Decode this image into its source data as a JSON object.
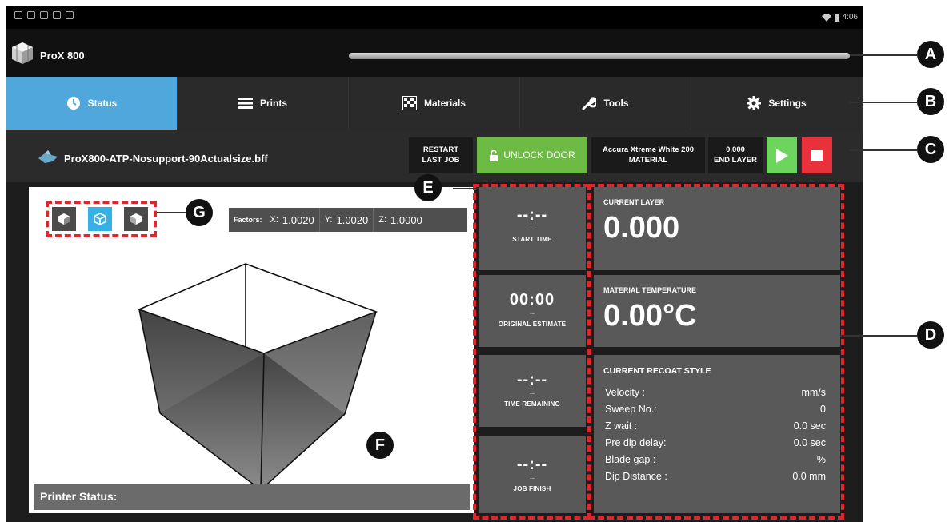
{
  "status_bar": {
    "time": "4:06"
  },
  "app": {
    "title": "ProX 800",
    "progress_fraction": 1.0
  },
  "tabs": [
    {
      "label": "Status",
      "icon": "clock-icon",
      "active": true
    },
    {
      "label": "Prints",
      "icon": "list-icon",
      "active": false
    },
    {
      "label": "Materials",
      "icon": "materials-grid-icon",
      "active": false
    },
    {
      "label": "Tools",
      "icon": "wrench-icon",
      "active": false
    },
    {
      "label": "Settings",
      "icon": "gear-icon",
      "active": false
    }
  ],
  "job": {
    "filename": "ProX800-ATP-Nosupport-90Actualsize.bff",
    "restart_label_1": "RESTART",
    "restart_label_2": "LAST JOB",
    "unlock_label": "UNLOCK DOOR",
    "material_label_1": "Accura Xtreme White 200",
    "material_label_2": "MATERIAL",
    "end_layer_value": "0.000",
    "end_layer_label": "END LAYER"
  },
  "viewer": {
    "factors_label": "Factors:",
    "factor_x_key": "X:",
    "factor_x": "1.0020",
    "factor_y_key": "Y:",
    "factor_y": "1.0020",
    "factor_z_key": "Z:",
    "factor_z": "1.0000",
    "printer_status_label": "Printer Status:"
  },
  "times": [
    {
      "value": "--:--",
      "dash": "--",
      "label": "START TIME"
    },
    {
      "value": "00:00",
      "dash": "--",
      "label": "ORIGINAL ESTIMATE"
    },
    {
      "value": "--:--",
      "dash": "--",
      "label": "TIME REMAINING"
    },
    {
      "value": "--:--",
      "dash": "--",
      "label": "JOB FINISH"
    }
  ],
  "current_layer": {
    "label": "CURRENT LAYER",
    "value": "0.000"
  },
  "material_temp": {
    "label": "MATERIAL TEMPERATURE",
    "value": "0.00°C"
  },
  "recoat": {
    "title": "CURRENT RECOAT STYLE",
    "rows": [
      {
        "k": "Velocity :",
        "v": "mm/s"
      },
      {
        "k": "Sweep No.:",
        "v": "0"
      },
      {
        "k": "Z wait :",
        "v": "0.0  sec"
      },
      {
        "k": "Pre dip delay:",
        "v": "0.0  sec"
      },
      {
        "k": "Blade gap :",
        "v": "%"
      },
      {
        "k": "Dip Distance :",
        "v": "0.0 mm"
      }
    ]
  },
  "callouts": {
    "a": "A",
    "b": "B",
    "c": "C",
    "d": "D",
    "e": "E",
    "f": "F",
    "g": "G"
  },
  "colors": {
    "accent_blue": "#4fa7dc",
    "unlock_green": "#6dbb45",
    "play_green": "#6dd55e",
    "stop_red": "#e8313a",
    "dash_red": "#e0262d",
    "selected_view": "#36b1e6"
  }
}
